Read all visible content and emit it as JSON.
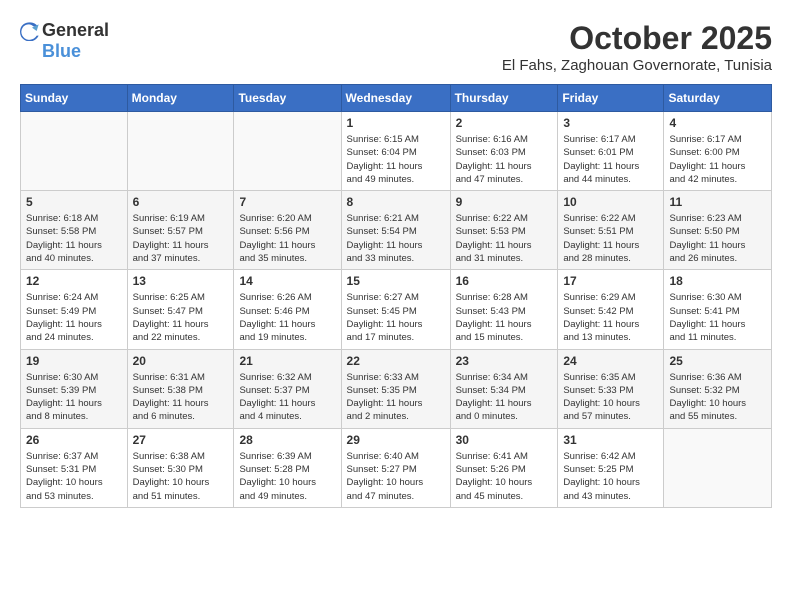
{
  "header": {
    "logo_general": "General",
    "logo_blue": "Blue",
    "month_title": "October 2025",
    "subtitle": "El Fahs, Zaghouan Governorate, Tunisia"
  },
  "weekdays": [
    "Sunday",
    "Monday",
    "Tuesday",
    "Wednesday",
    "Thursday",
    "Friday",
    "Saturday"
  ],
  "weeks": [
    [
      {
        "day": "",
        "info": ""
      },
      {
        "day": "",
        "info": ""
      },
      {
        "day": "",
        "info": ""
      },
      {
        "day": "1",
        "info": "Sunrise: 6:15 AM\nSunset: 6:04 PM\nDaylight: 11 hours\nand 49 minutes."
      },
      {
        "day": "2",
        "info": "Sunrise: 6:16 AM\nSunset: 6:03 PM\nDaylight: 11 hours\nand 47 minutes."
      },
      {
        "day": "3",
        "info": "Sunrise: 6:17 AM\nSunset: 6:01 PM\nDaylight: 11 hours\nand 44 minutes."
      },
      {
        "day": "4",
        "info": "Sunrise: 6:17 AM\nSunset: 6:00 PM\nDaylight: 11 hours\nand 42 minutes."
      }
    ],
    [
      {
        "day": "5",
        "info": "Sunrise: 6:18 AM\nSunset: 5:58 PM\nDaylight: 11 hours\nand 40 minutes."
      },
      {
        "day": "6",
        "info": "Sunrise: 6:19 AM\nSunset: 5:57 PM\nDaylight: 11 hours\nand 37 minutes."
      },
      {
        "day": "7",
        "info": "Sunrise: 6:20 AM\nSunset: 5:56 PM\nDaylight: 11 hours\nand 35 minutes."
      },
      {
        "day": "8",
        "info": "Sunrise: 6:21 AM\nSunset: 5:54 PM\nDaylight: 11 hours\nand 33 minutes."
      },
      {
        "day": "9",
        "info": "Sunrise: 6:22 AM\nSunset: 5:53 PM\nDaylight: 11 hours\nand 31 minutes."
      },
      {
        "day": "10",
        "info": "Sunrise: 6:22 AM\nSunset: 5:51 PM\nDaylight: 11 hours\nand 28 minutes."
      },
      {
        "day": "11",
        "info": "Sunrise: 6:23 AM\nSunset: 5:50 PM\nDaylight: 11 hours\nand 26 minutes."
      }
    ],
    [
      {
        "day": "12",
        "info": "Sunrise: 6:24 AM\nSunset: 5:49 PM\nDaylight: 11 hours\nand 24 minutes."
      },
      {
        "day": "13",
        "info": "Sunrise: 6:25 AM\nSunset: 5:47 PM\nDaylight: 11 hours\nand 22 minutes."
      },
      {
        "day": "14",
        "info": "Sunrise: 6:26 AM\nSunset: 5:46 PM\nDaylight: 11 hours\nand 19 minutes."
      },
      {
        "day": "15",
        "info": "Sunrise: 6:27 AM\nSunset: 5:45 PM\nDaylight: 11 hours\nand 17 minutes."
      },
      {
        "day": "16",
        "info": "Sunrise: 6:28 AM\nSunset: 5:43 PM\nDaylight: 11 hours\nand 15 minutes."
      },
      {
        "day": "17",
        "info": "Sunrise: 6:29 AM\nSunset: 5:42 PM\nDaylight: 11 hours\nand 13 minutes."
      },
      {
        "day": "18",
        "info": "Sunrise: 6:30 AM\nSunset: 5:41 PM\nDaylight: 11 hours\nand 11 minutes."
      }
    ],
    [
      {
        "day": "19",
        "info": "Sunrise: 6:30 AM\nSunset: 5:39 PM\nDaylight: 11 hours\nand 8 minutes."
      },
      {
        "day": "20",
        "info": "Sunrise: 6:31 AM\nSunset: 5:38 PM\nDaylight: 11 hours\nand 6 minutes."
      },
      {
        "day": "21",
        "info": "Sunrise: 6:32 AM\nSunset: 5:37 PM\nDaylight: 11 hours\nand 4 minutes."
      },
      {
        "day": "22",
        "info": "Sunrise: 6:33 AM\nSunset: 5:35 PM\nDaylight: 11 hours\nand 2 minutes."
      },
      {
        "day": "23",
        "info": "Sunrise: 6:34 AM\nSunset: 5:34 PM\nDaylight: 11 hours\nand 0 minutes."
      },
      {
        "day": "24",
        "info": "Sunrise: 6:35 AM\nSunset: 5:33 PM\nDaylight: 10 hours\nand 57 minutes."
      },
      {
        "day": "25",
        "info": "Sunrise: 6:36 AM\nSunset: 5:32 PM\nDaylight: 10 hours\nand 55 minutes."
      }
    ],
    [
      {
        "day": "26",
        "info": "Sunrise: 6:37 AM\nSunset: 5:31 PM\nDaylight: 10 hours\nand 53 minutes."
      },
      {
        "day": "27",
        "info": "Sunrise: 6:38 AM\nSunset: 5:30 PM\nDaylight: 10 hours\nand 51 minutes."
      },
      {
        "day": "28",
        "info": "Sunrise: 6:39 AM\nSunset: 5:28 PM\nDaylight: 10 hours\nand 49 minutes."
      },
      {
        "day": "29",
        "info": "Sunrise: 6:40 AM\nSunset: 5:27 PM\nDaylight: 10 hours\nand 47 minutes."
      },
      {
        "day": "30",
        "info": "Sunrise: 6:41 AM\nSunset: 5:26 PM\nDaylight: 10 hours\nand 45 minutes."
      },
      {
        "day": "31",
        "info": "Sunrise: 6:42 AM\nSunset: 5:25 PM\nDaylight: 10 hours\nand 43 minutes."
      },
      {
        "day": "",
        "info": ""
      }
    ]
  ]
}
